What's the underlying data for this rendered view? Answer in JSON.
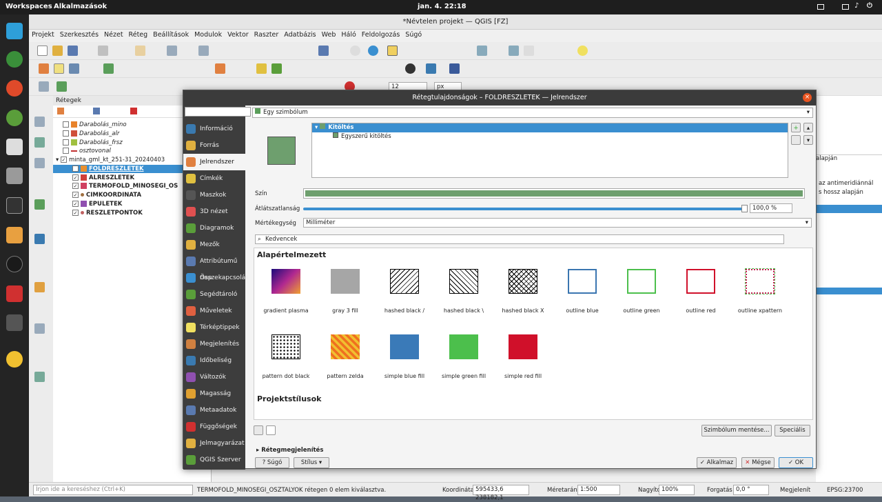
{
  "os": {
    "workspaces": "Workspaces",
    "apps": "Alkalmazások",
    "clock": "jan. 4.  22:18"
  },
  "qgis": {
    "title": "*Névtelen projekt — QGIS [FZ]",
    "menu": [
      "Projekt",
      "Szerkesztés",
      "Nézet",
      "Réteg",
      "Beállítások",
      "Modulok",
      "Vektor",
      "Raszter",
      "Adatbázis",
      "Web",
      "Háló",
      "Feldolgozás",
      "Súgó"
    ],
    "font_size": "12",
    "unit": "px"
  },
  "layers": {
    "header": "Rétegek",
    "items": [
      {
        "label": "Darabolás_mino",
        "color": "#e8822a",
        "checked": false
      },
      {
        "label": "Darabolás_alr",
        "color": "#d0503a",
        "checked": false
      },
      {
        "label": "Darabolás_frsz",
        "color": "#a0c040",
        "checked": false
      },
      {
        "label": "osztovonal",
        "color": "#c03030",
        "checked": false
      },
      {
        "label": "minta_gml_kt_251-31_20240403",
        "color": "",
        "checked": true
      },
      {
        "label": "FOLDRESZLETEK",
        "color": "#e89030",
        "checked": true
      },
      {
        "label": "ALRESZLETEK",
        "color": "#d0403a",
        "checked": true
      },
      {
        "label": "TERMOFOLD_MINOSEGI_OS",
        "color": "#d04060",
        "checked": true
      },
      {
        "label": "CIMKOORDINATA",
        "color": "#a07040",
        "checked": true
      },
      {
        "label": "EPULETEK",
        "color": "#9050b0",
        "checked": true
      },
      {
        "label": "RESZLETPONTOK",
        "color": "#c06060",
        "checked": true
      }
    ]
  },
  "right": {
    "t1": "alapján",
    "t2": "az antimeridiánnál",
    "t3": "s hossz alapján"
  },
  "dialog": {
    "title": "Rétegtulajdonságok – FOLDRESZLETEK — Jelrendszer",
    "renderer": "Egy szimbólum",
    "tree_root": "Kitöltés",
    "tree_child": "Egyszerű kitöltés",
    "color_label": "Szín",
    "opacity_label": "Átlátszatlanság",
    "opacity_value": "100,0 %",
    "unit_label": "Mértékegység",
    "unit_value": "Milliméter",
    "search_value": "Kedvencek",
    "section_default": "Alapértelmezett",
    "section_project": "Projektstílusok",
    "save_symbol": "Szimbólum mentése...",
    "advanced": "Speciális",
    "layer_render": "Rétegmegjelenítés",
    "help": "Súgó",
    "style": "Stílus",
    "apply": "Alkalmaz",
    "cancel": "Mégse",
    "ok": "OK",
    "symbols": [
      "gradient  plasma",
      "gray 3 fill",
      "hashed black /",
      "hashed black \\",
      "hashed black X",
      "outline blue",
      "outline green",
      "outline red",
      "outline xpattern",
      "pattern dot black",
      "pattern zelda",
      "simple blue fill",
      "simple green fill",
      "simple red fill"
    ]
  },
  "nav": [
    "Információ",
    "Forrás",
    "Jelrendszer",
    "Címkék",
    "Maszkok",
    "3D nézet",
    "Diagramok",
    "Mezők",
    "Attribútumű rlap",
    "Összekapcsolás",
    "Segédtároló",
    "Műveletek",
    "Térképtippek",
    "Megjelenítés",
    "Időbeliség",
    "Változók",
    "Magasság",
    "Metaadatok",
    "Függőségek",
    "Jelmagyarázat",
    "QGIS Szerver"
  ],
  "status": {
    "search_placeholder": "Írjon ide a kereséshez (Ctrl+K)",
    "message": "TERMOFOLD_MINOSEGI_OSZTALYOK rétegen 0 elem kiválasztva.",
    "coord_label": "Koordináta",
    "coord": "595433,6  238182,1",
    "scale_label": "Méretarány",
    "scale": "1:500",
    "magnifier_label": "Nagyító",
    "magnifier": "100%",
    "rotation_label": "Forgatás",
    "rotation": "0,0 °",
    "render_label": "Megjelenít",
    "epsg": "EPSG:23700"
  },
  "colors": {
    "fill": "#6e9f6e",
    "accent": "#3a8fd0",
    "nav_bg": "#3d3d3d"
  }
}
